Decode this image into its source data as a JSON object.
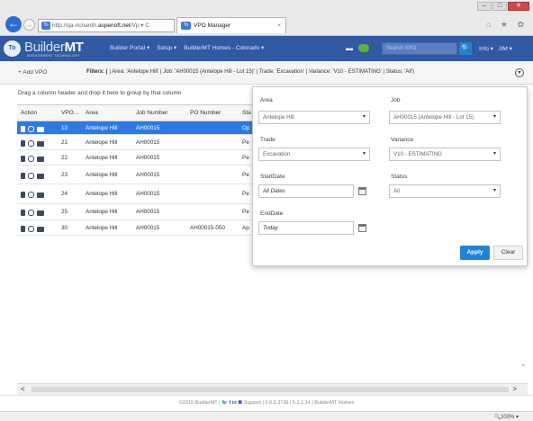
{
  "browser": {
    "window_buttons": [
      "–",
      "□",
      "✕"
    ],
    "back_glyph": "←",
    "fwd_glyph": "→",
    "url_prefix": "http://qa-richardh.",
    "url_host": "aspenoft.net",
    "url_suffix": "/Vp ▾ C",
    "url_favicon": "To",
    "tab_title": "VPO Manager",
    "tab_favicon": "To",
    "tab_close": "×",
    "toolbar_icons": "⌂ ★ ✿"
  },
  "app": {
    "logo_badge": "To",
    "logo_builder": "Builder",
    "logo_mt": "MT",
    "logo_tagline": "MANAGEMENT TECHNOLOGY",
    "nav": [
      "Builder Portal",
      "Setup",
      "BuilderMT Homes - Colorado"
    ],
    "flag_icon": "▬",
    "search_placeholder": "Search VPO",
    "search_icon": "🔍",
    "info_label": "Info ▾",
    "user_label": "JIM ▾"
  },
  "toolbar": {
    "add_vpo": "+ Add VPO",
    "filters_prefix": "Filters: (",
    "filters_text": "| Area: 'Antelope Hill' | Job: 'AH00015 (Antelope Hill - Lot 15)' | Trade: 'Excavation' | Variance: 'V10 - ESTIMATING' | Status: 'All')",
    "toggle_icon": "▾"
  },
  "grid": {
    "group_hint": "Drag a column header and drop it here to group by that column",
    "headers": {
      "action": "Action",
      "vpo": "VPO...",
      "area": "Area",
      "job": "Job Number",
      "po": "PO Number",
      "status": "Sta"
    },
    "rows": [
      {
        "vpo": "13",
        "area": "Antelope Hill",
        "job": "AH00015",
        "po": "",
        "status": "Op"
      },
      {
        "vpo": "21",
        "area": "Antelope Hill",
        "job": "AH00015",
        "po": "",
        "status": "Pe"
      },
      {
        "vpo": "22",
        "area": "Antelope Hill",
        "job": "AH00015",
        "po": "",
        "status": "Pe"
      },
      {
        "vpo": "23",
        "area": "Antelope Hill",
        "job": "AH00015",
        "po": "",
        "status": "Pe"
      },
      {
        "vpo": "24",
        "area": "Antelope Hill",
        "job": "AH00015",
        "po": "",
        "status": "Pe"
      },
      {
        "vpo": "25",
        "area": "Antelope Hill",
        "job": "AH00015",
        "po": "",
        "status": "Pe"
      },
      {
        "vpo": "30",
        "area": "Antelope Hill",
        "job": "AH00015",
        "po": "AH00015-050",
        "status": "Ap"
      }
    ],
    "scroll_down": "⌄",
    "scroll_left": "<",
    "scroll_right": ">"
  },
  "filter_panel": {
    "area_label": "Area",
    "area_value": "Antelope Hill",
    "job_label": "Job",
    "job_value": "AH00015 (Antelope Hill - Lot 15)",
    "trade_label": "Trade",
    "trade_value": "Excavation",
    "variance_label": "Variance",
    "variance_value": "V10 - ESTIMATING",
    "startdate_label": "StartDate",
    "startdate_value": "All Dates",
    "status_label": "Status",
    "status_value": "All",
    "enddate_label": "EndDate",
    "enddate_value": "Today",
    "apply_label": "Apply",
    "clear_label": "Clear",
    "dropdown_glyph": "▾"
  },
  "footer": {
    "copyright": "©2015 BuilderMT |",
    "social": "🐦 f in ❷",
    "support": "Support | 0.0.0.3736 | 5.2.1.14 | BuilderMT Homes"
  },
  "status": {
    "zoom": "🔍100% ▾"
  }
}
